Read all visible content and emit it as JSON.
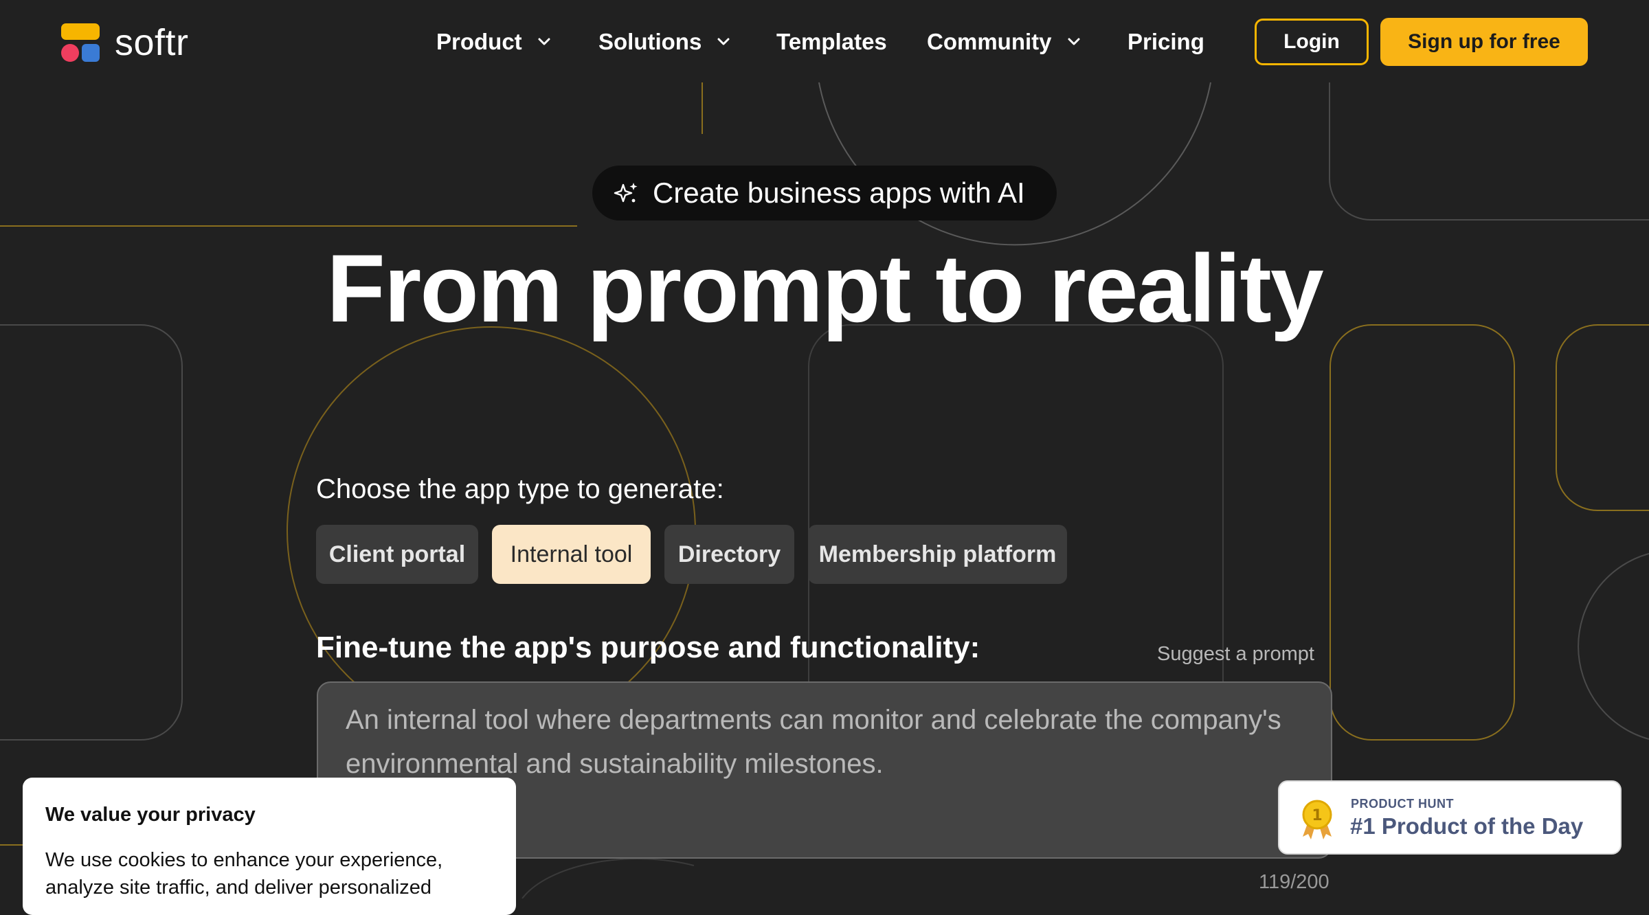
{
  "brand": {
    "name": "softr"
  },
  "nav": {
    "items": [
      {
        "label": "Product",
        "has_dropdown": true
      },
      {
        "label": "Solutions",
        "has_dropdown": true
      },
      {
        "label": "Templates",
        "has_dropdown": false
      },
      {
        "label": "Community",
        "has_dropdown": true
      },
      {
        "label": "Pricing",
        "has_dropdown": false
      }
    ],
    "login_label": "Login",
    "signup_label": "Sign up for free"
  },
  "hero": {
    "badge_icon": "sparkles-icon",
    "badge_text": "Create business apps with AI",
    "title": "From prompt to reality"
  },
  "generator": {
    "choose_label": "Choose the app type to generate:",
    "app_types": [
      {
        "label": "Client portal",
        "selected": false
      },
      {
        "label": "Internal tool",
        "selected": true
      },
      {
        "label": "Directory",
        "selected": false
      },
      {
        "label": "Membership platform",
        "selected": false
      }
    ],
    "fine_tune_label": "Fine-tune the app's purpose and functionality:",
    "suggest_label": "Suggest a prompt",
    "prompt_value": "An internal tool where departments can monitor and celebrate the company's environmental and sustainability milestones.",
    "char_count": "119/200"
  },
  "cookie_banner": {
    "title": "We value your privacy",
    "text": "We use cookies to enhance your experience, analyze site traffic, and deliver personalized"
  },
  "product_hunt": {
    "medal_number": "1",
    "eyebrow": "PRODUCT HUNT",
    "title": "#1 Product of the Day"
  },
  "colors": {
    "background": "#212121",
    "accent": "#f9b415",
    "chip": "#3b3b3b",
    "chip_selected": "#fbe6c6",
    "logo_yellow": "#f7b500",
    "logo_red": "#ef3e5f",
    "logo_blue": "#3a7bd5"
  }
}
